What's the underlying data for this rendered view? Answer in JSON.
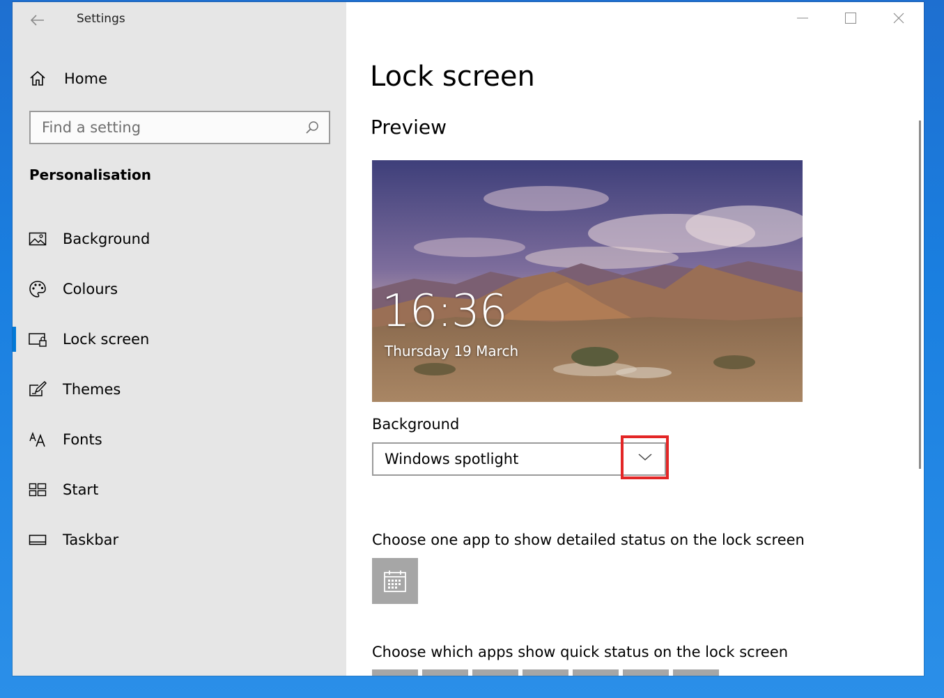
{
  "window": {
    "title": "Settings"
  },
  "sidebar": {
    "home_label": "Home",
    "search_placeholder": "Find a setting",
    "section_title": "Personalisation",
    "items": [
      {
        "label": "Background",
        "icon": "image-icon"
      },
      {
        "label": "Colours",
        "icon": "palette-icon"
      },
      {
        "label": "Lock screen",
        "icon": "lock-screen-icon",
        "active": true
      },
      {
        "label": "Themes",
        "icon": "themes-icon"
      },
      {
        "label": "Fonts",
        "icon": "fonts-icon"
      },
      {
        "label": "Start",
        "icon": "start-icon"
      },
      {
        "label": "Taskbar",
        "icon": "taskbar-icon"
      }
    ]
  },
  "main": {
    "page_title": "Lock screen",
    "preview_title": "Preview",
    "preview": {
      "time": "16:36",
      "date": "Thursday 19 March"
    },
    "background_label": "Background",
    "background_value": "Windows spotlight",
    "detailed_status_label": "Choose one app to show detailed status on the lock screen",
    "quick_status_label": "Choose which apps show quick status on the lock screen"
  },
  "colors": {
    "accent": "#0078d7",
    "highlight": "#e32626",
    "sidebar_bg": "#e6e6e6",
    "tile_bg": "#a6a6a6"
  }
}
